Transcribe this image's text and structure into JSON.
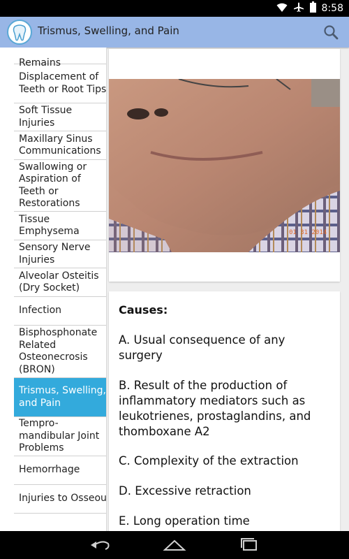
{
  "status_bar": {
    "time": "8:58"
  },
  "action_bar": {
    "title": "Trismus, Swelling, and Pain"
  },
  "sidebar": {
    "items": [
      {
        "label": "Remains"
      },
      {
        "label": "Displacement of Teeth or Root Tips"
      },
      {
        "label": "Soft Tissue Injuries"
      },
      {
        "label": "Maxillary Sinus Communications"
      },
      {
        "label": "Swallowing or Aspiration of Teeth or Restorations"
      },
      {
        "label": "Tissue Emphysema"
      },
      {
        "label": "Sensory Nerve Injuries"
      },
      {
        "label": "Alveolar Osteitis (Dry Socket)"
      },
      {
        "label": "Infection"
      },
      {
        "label": "Bisphosphonate Related Osteonecrosis (BRON)"
      },
      {
        "label": "Trismus, Swelling, and Pain"
      },
      {
        "label": "Tempro-mandibular Joint Problems"
      },
      {
        "label": "Hemorrhage"
      },
      {
        "label": "Injuries to Osseous"
      }
    ],
    "active_index": 10
  },
  "content": {
    "photo_datestamp": "01 31 2014",
    "causes_heading": "Causes:",
    "causes": [
      "A. Usual consequence of any surgery",
      "B. Result of the production of inflammatory mediators such as leukotrienes, prostaglandins, and thomboxane A2",
      "C. Complexity of the extraction",
      "D. Excessive retraction",
      "E. Long operation time"
    ]
  },
  "colors": {
    "action_bar": "#98b6e6",
    "active_item": "#33aadc",
    "status_bar": "#000000"
  },
  "icons": {
    "logo": "tooth-logo-icon",
    "search": "search-icon",
    "wifi": "wifi-icon",
    "airplane": "airplane-icon",
    "battery": "battery-icon",
    "back": "back-icon",
    "home": "home-icon",
    "recents": "recents-icon"
  }
}
